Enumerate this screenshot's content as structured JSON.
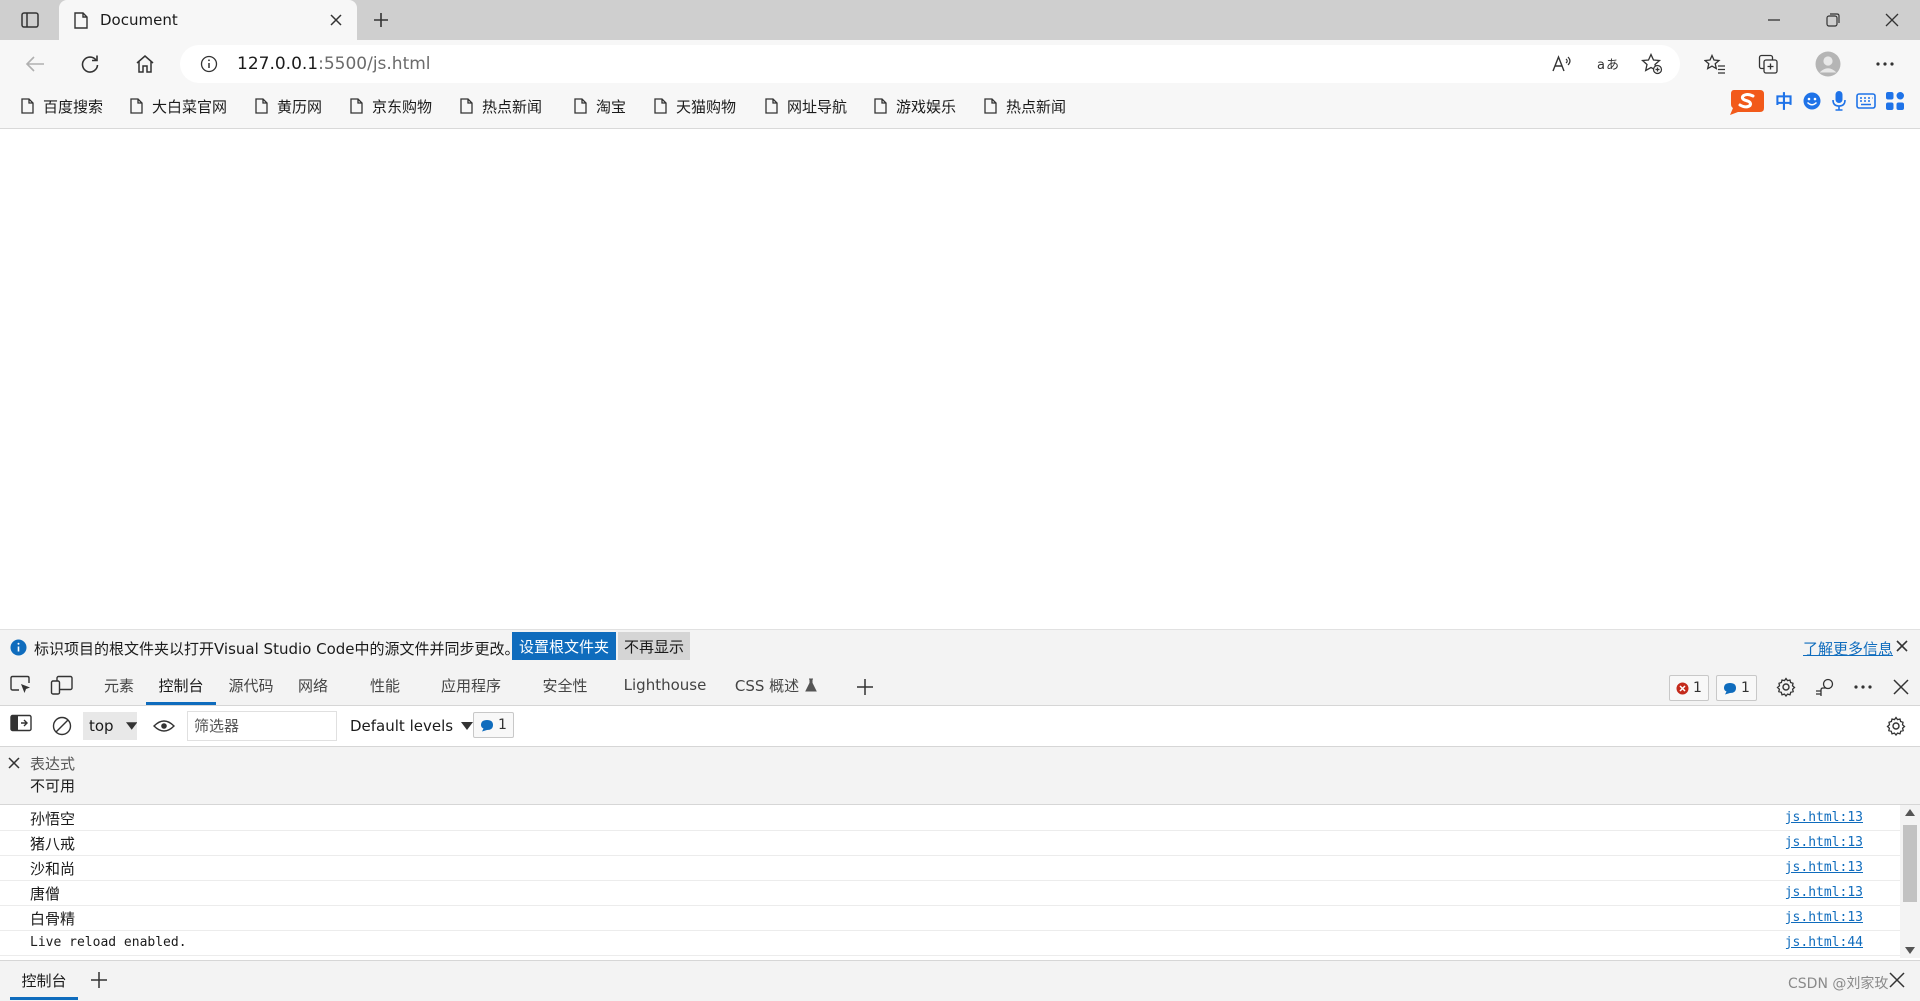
{
  "browser": {
    "tab": {
      "title": "Document"
    },
    "address_bar": {
      "url_host": "127.0.0.1",
      "url_rest": ":5500/js.html"
    },
    "bookmarks": [
      "百度搜索",
      "大白菜官网",
      "黄历网",
      "京东购物",
      "热点新闻",
      "淘宝",
      "天猫购物",
      "网址导航",
      "游戏娱乐",
      "热点新闻"
    ],
    "ime_toolbar": {
      "lang": "中"
    }
  },
  "devtools": {
    "infobar": {
      "message": "标识项目的根文件夹以打开Visual Studio Code中的源文件并同步更改。",
      "set_root_button": "设置根文件夹",
      "dont_show_button": "不再显示",
      "learn_more_link": "了解更多信息"
    },
    "tabs": [
      "元素",
      "控制台",
      "源代码",
      "网络",
      "性能",
      "应用程序",
      "安全性",
      "Lighthouse",
      "CSS 概述"
    ],
    "active_tab": "控制台",
    "error_count": "1",
    "message_count": "1",
    "console_toolbar": {
      "context": "top",
      "filter_placeholder": "筛选器",
      "levels": "Default levels",
      "issues_count": "1"
    },
    "live_expression": {
      "title": "表达式",
      "value": "不可用"
    },
    "console_rows": [
      {
        "text": "孙悟空",
        "source": "js.html:13"
      },
      {
        "text": "猪八戒",
        "source": "js.html:13"
      },
      {
        "text": "沙和尚",
        "source": "js.html:13"
      },
      {
        "text": "唐僧",
        "source": "js.html:13"
      },
      {
        "text": "白骨精",
        "source": "js.html:13"
      },
      {
        "text": "Live reload enabled.",
        "source": "js.html:44"
      }
    ],
    "drawer": {
      "tab": "控制台"
    }
  },
  "watermark": "CSDN @刘家玫",
  "colors": {
    "accent": "#0f6cbd",
    "error": "#c42b1c",
    "tabstrip": "#cfcfcf",
    "toolbar": "#f7f7f7",
    "ime_orange": "#f25a1a",
    "ime_blue": "#1f73e8"
  }
}
